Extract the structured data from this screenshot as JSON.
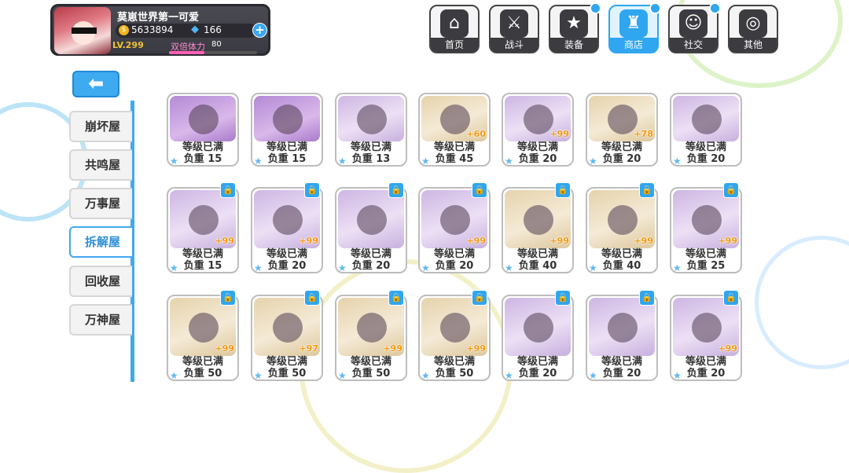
{
  "player": {
    "name": "莫崽世界第一可爱",
    "coins": "5633894",
    "crystals": "166",
    "level": "LV.299",
    "stamina_label": "双倍体力",
    "stamina_value": "80",
    "stamina_fraction": 0.4,
    "add_label": "+"
  },
  "nav": [
    {
      "label": "首页",
      "icon": "home-icon",
      "glyph": "⌂",
      "badge": false,
      "active": false
    },
    {
      "label": "战斗",
      "icon": "battle-icon",
      "glyph": "⚔",
      "badge": false,
      "active": false
    },
    {
      "label": "装备",
      "icon": "equipment-icon",
      "glyph": "★",
      "badge": true,
      "active": false
    },
    {
      "label": "商店",
      "icon": "shop-basket-icon",
      "glyph": "♜",
      "badge": true,
      "active": true
    },
    {
      "label": "社交",
      "icon": "social-icon",
      "glyph": "☺",
      "badge": true,
      "active": false
    },
    {
      "label": "其他",
      "icon": "other-icon",
      "glyph": "◎",
      "badge": false,
      "active": false
    }
  ],
  "back_glyph": "⬅",
  "sidebar": [
    {
      "label": "崩坏屋",
      "active": false
    },
    {
      "label": "共鸣屋",
      "active": false
    },
    {
      "label": "万事屋",
      "active": false
    },
    {
      "label": "拆解屋",
      "active": true
    },
    {
      "label": "回收屋",
      "active": false
    },
    {
      "label": "万神屋",
      "active": false
    }
  ],
  "colors": {
    "accent": "#2fa6ef",
    "bonus": "#f39a10",
    "purple_card": "#c9a3dc",
    "gold_card": "#e9dcc0",
    "lilac_card": "#d8c4e8"
  },
  "items": [
    {
      "status": "等级已满",
      "weight": "负重 15",
      "bonus": "",
      "locked": false,
      "tone": "purple"
    },
    {
      "status": "等级已满",
      "weight": "负重 15",
      "bonus": "",
      "locked": false,
      "tone": "purple"
    },
    {
      "status": "等级已满",
      "weight": "负重 13",
      "bonus": "",
      "locked": false,
      "tone": "lilac"
    },
    {
      "status": "等级已满",
      "weight": "负重 45",
      "bonus": "+60",
      "locked": false,
      "tone": "gold"
    },
    {
      "status": "等级已满",
      "weight": "负重 20",
      "bonus": "+99",
      "locked": false,
      "tone": "lilac"
    },
    {
      "status": "等级已满",
      "weight": "负重 20",
      "bonus": "+78",
      "locked": false,
      "tone": "gold"
    },
    {
      "status": "等级已满",
      "weight": "负重 20",
      "bonus": "",
      "locked": false,
      "tone": "lilac"
    },
    {
      "status": "等级已满",
      "weight": "负重 15",
      "bonus": "+99",
      "locked": true,
      "tone": "lilac"
    },
    {
      "status": "等级已满",
      "weight": "负重 20",
      "bonus": "+99",
      "locked": true,
      "tone": "lilac"
    },
    {
      "status": "等级已满",
      "weight": "负重 20",
      "bonus": "",
      "locked": true,
      "tone": "lilac"
    },
    {
      "status": "等级已满",
      "weight": "负重 20",
      "bonus": "+99",
      "locked": true,
      "tone": "lilac"
    },
    {
      "status": "等级已满",
      "weight": "负重 40",
      "bonus": "+99",
      "locked": true,
      "tone": "gold"
    },
    {
      "status": "等级已满",
      "weight": "负重 40",
      "bonus": "+99",
      "locked": true,
      "tone": "gold"
    },
    {
      "status": "等级已满",
      "weight": "负重 25",
      "bonus": "+99",
      "locked": true,
      "tone": "lilac"
    },
    {
      "status": "等级已满",
      "weight": "负重 50",
      "bonus": "+99",
      "locked": true,
      "tone": "gold"
    },
    {
      "status": "等级已满",
      "weight": "负重 50",
      "bonus": "+97",
      "locked": true,
      "tone": "gold"
    },
    {
      "status": "等级已满",
      "weight": "负重 50",
      "bonus": "+99",
      "locked": true,
      "tone": "gold"
    },
    {
      "status": "等级已满",
      "weight": "负重 50",
      "bonus": "+99",
      "locked": true,
      "tone": "gold"
    },
    {
      "status": "等级已满",
      "weight": "负重 20",
      "bonus": "",
      "locked": true,
      "tone": "lilac"
    },
    {
      "status": "等级已满",
      "weight": "负重 20",
      "bonus": "",
      "locked": true,
      "tone": "lilac"
    },
    {
      "status": "等级已满",
      "weight": "负重 20",
      "bonus": "+99",
      "locked": true,
      "tone": "lilac"
    }
  ],
  "lock_glyph": "🔒",
  "star_glyph": "★"
}
